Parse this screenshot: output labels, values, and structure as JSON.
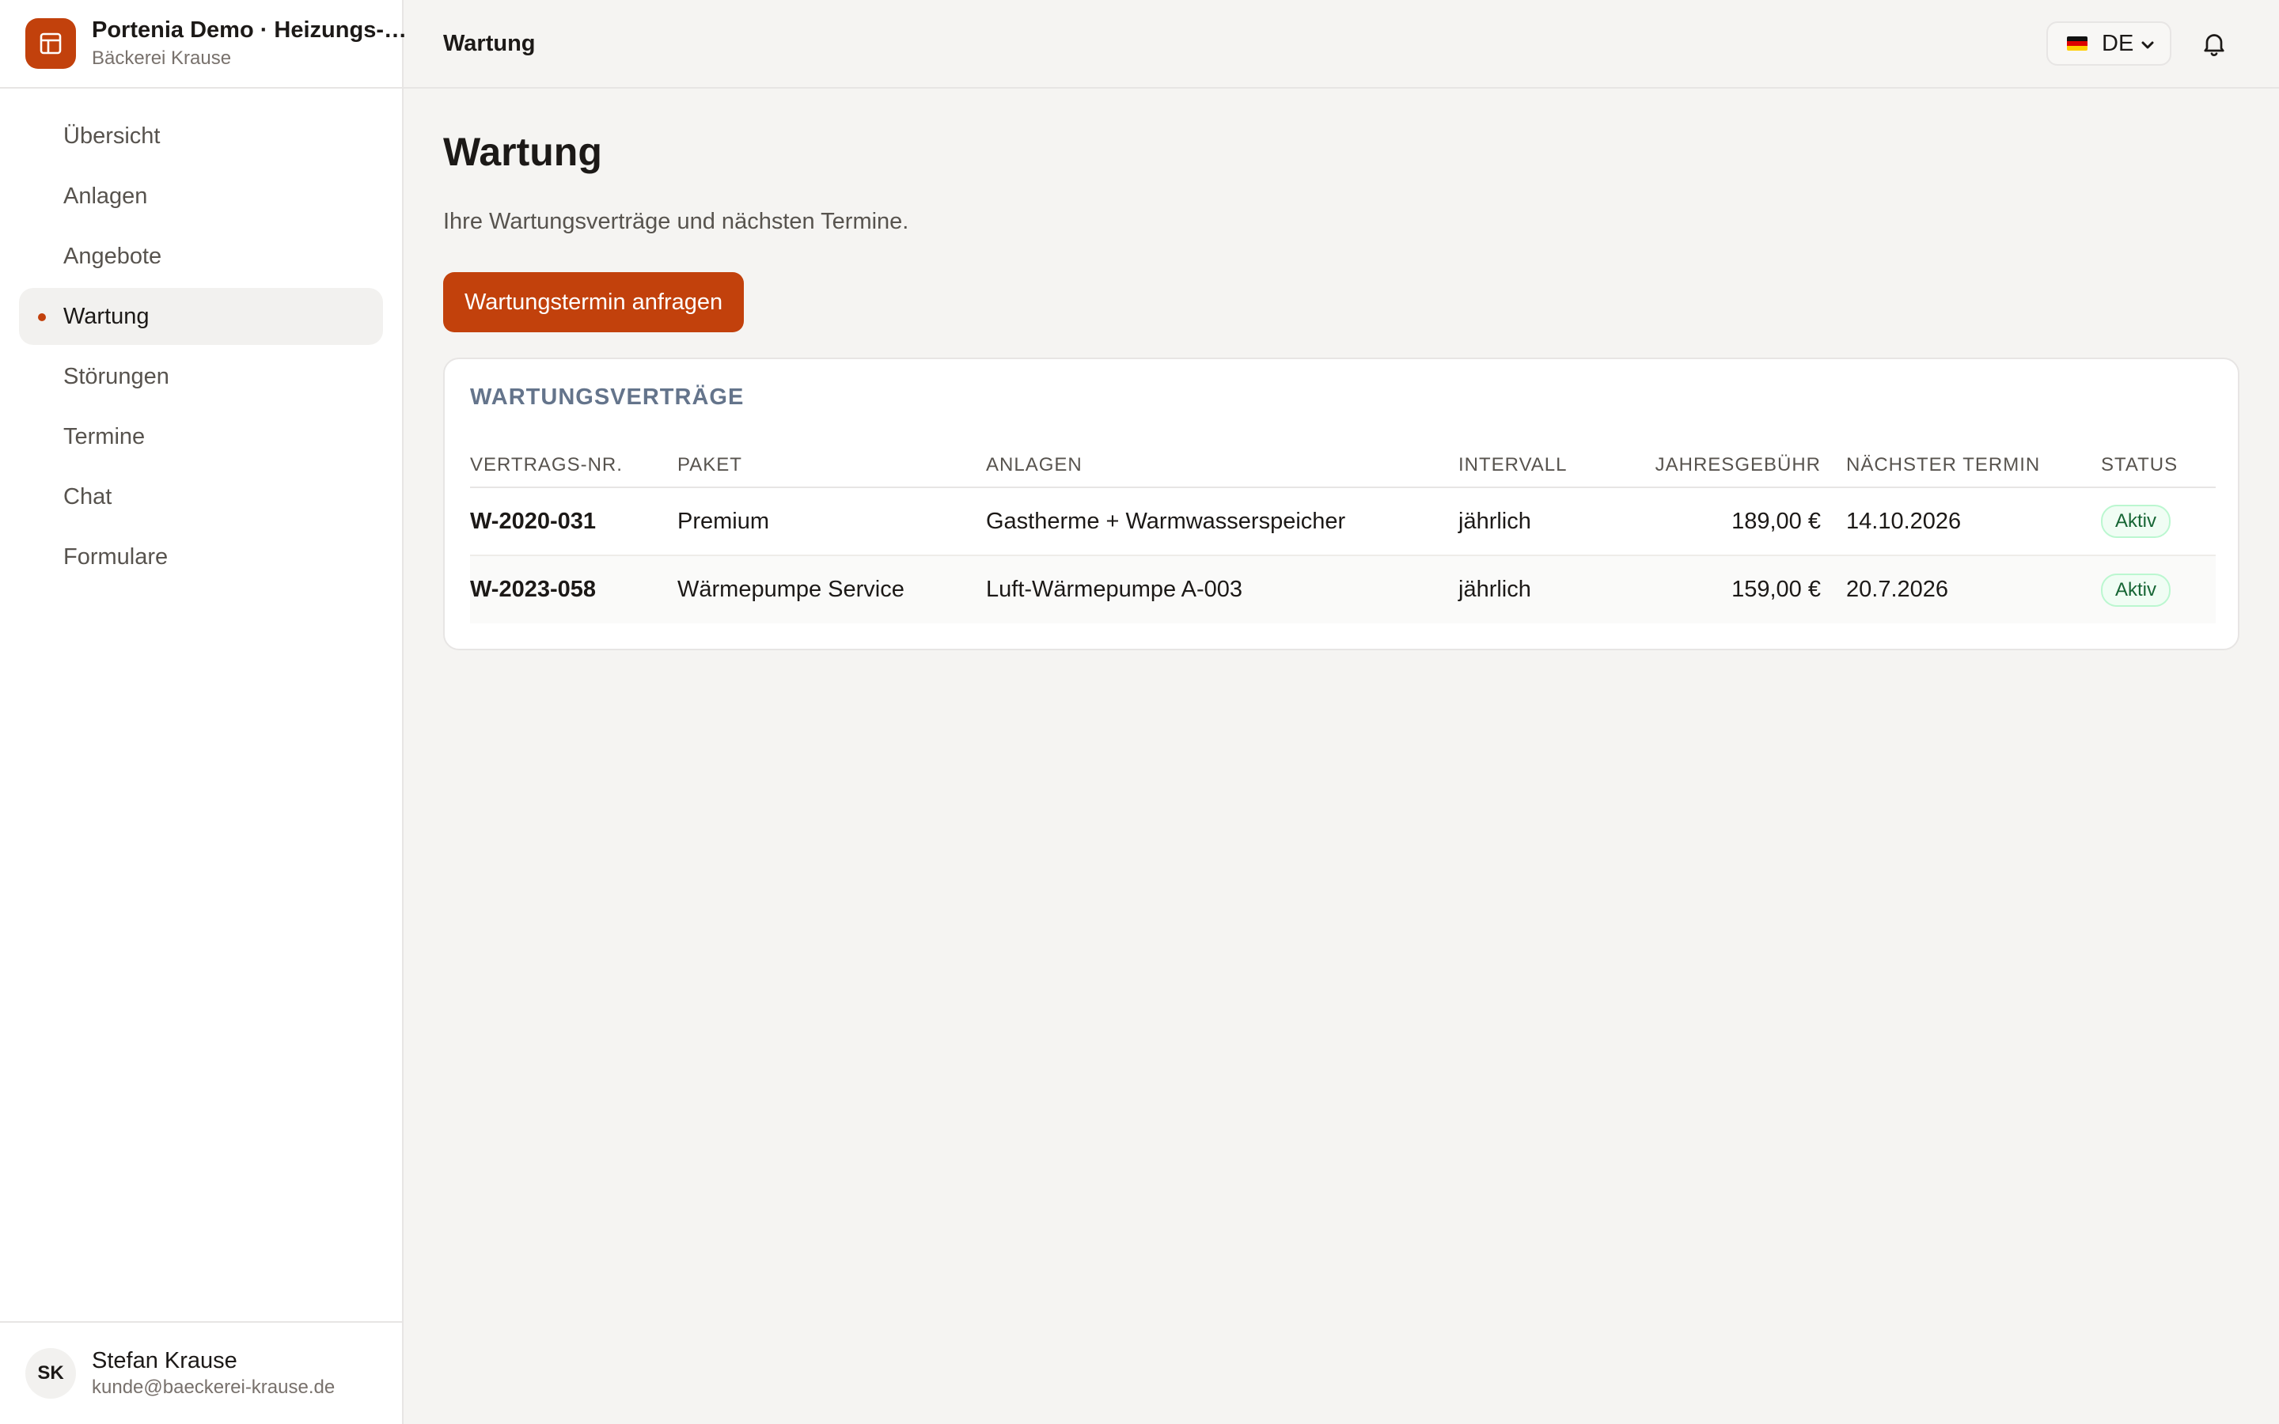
{
  "app": {
    "title": "Portenia Demo · Heizungs- und Sanitärtechnik",
    "subtitle": "Bäckerei Krause",
    "logo_icon": "building-icon",
    "accent_color": "#c2410c"
  },
  "sidebar": {
    "items": [
      {
        "label": "Übersicht",
        "active": false
      },
      {
        "label": "Anlagen",
        "active": false
      },
      {
        "label": "Angebote",
        "active": false
      },
      {
        "label": "Wartung",
        "active": true
      },
      {
        "label": "Störungen",
        "active": false
      },
      {
        "label": "Termine",
        "active": false
      },
      {
        "label": "Chat",
        "active": false
      },
      {
        "label": "Formulare",
        "active": false
      }
    ]
  },
  "user": {
    "initials": "SK",
    "name": "Stefan Krause",
    "email": "kunde@baeckerei-krause.de"
  },
  "topbar": {
    "title": "Wartung",
    "language": "DE",
    "language_flag": "de-flag-icon",
    "notifications_icon": "bell-icon"
  },
  "main": {
    "title": "Wartung",
    "subtitle": "Ihre Wartungsverträge und nächsten Termine.",
    "request_button": "Wartungstermin anfragen"
  },
  "contracts": {
    "title": "WARTUNGSVERTRÄGE",
    "columns": [
      "VERTRAGS-NR.",
      "PAKET",
      "ANLAGEN",
      "INTERVALL",
      "JAHRESGEBÜHR",
      "NÄCHSTER TERMIN",
      "STATUS"
    ],
    "rows": [
      {
        "id": "W-2020-031",
        "package": "Premium",
        "systems": "Gastherme + Warmwasserspeicher",
        "interval": "jährlich",
        "fee": "189,00 €",
        "next": "14.10.2026",
        "status": "Aktiv"
      },
      {
        "id": "W-2023-058",
        "package": "Wärmepumpe Service",
        "systems": "Luft-Wärmepumpe A-003",
        "interval": "jährlich",
        "fee": "159,00 €",
        "next": "20.7.2026",
        "status": "Aktiv"
      }
    ]
  }
}
